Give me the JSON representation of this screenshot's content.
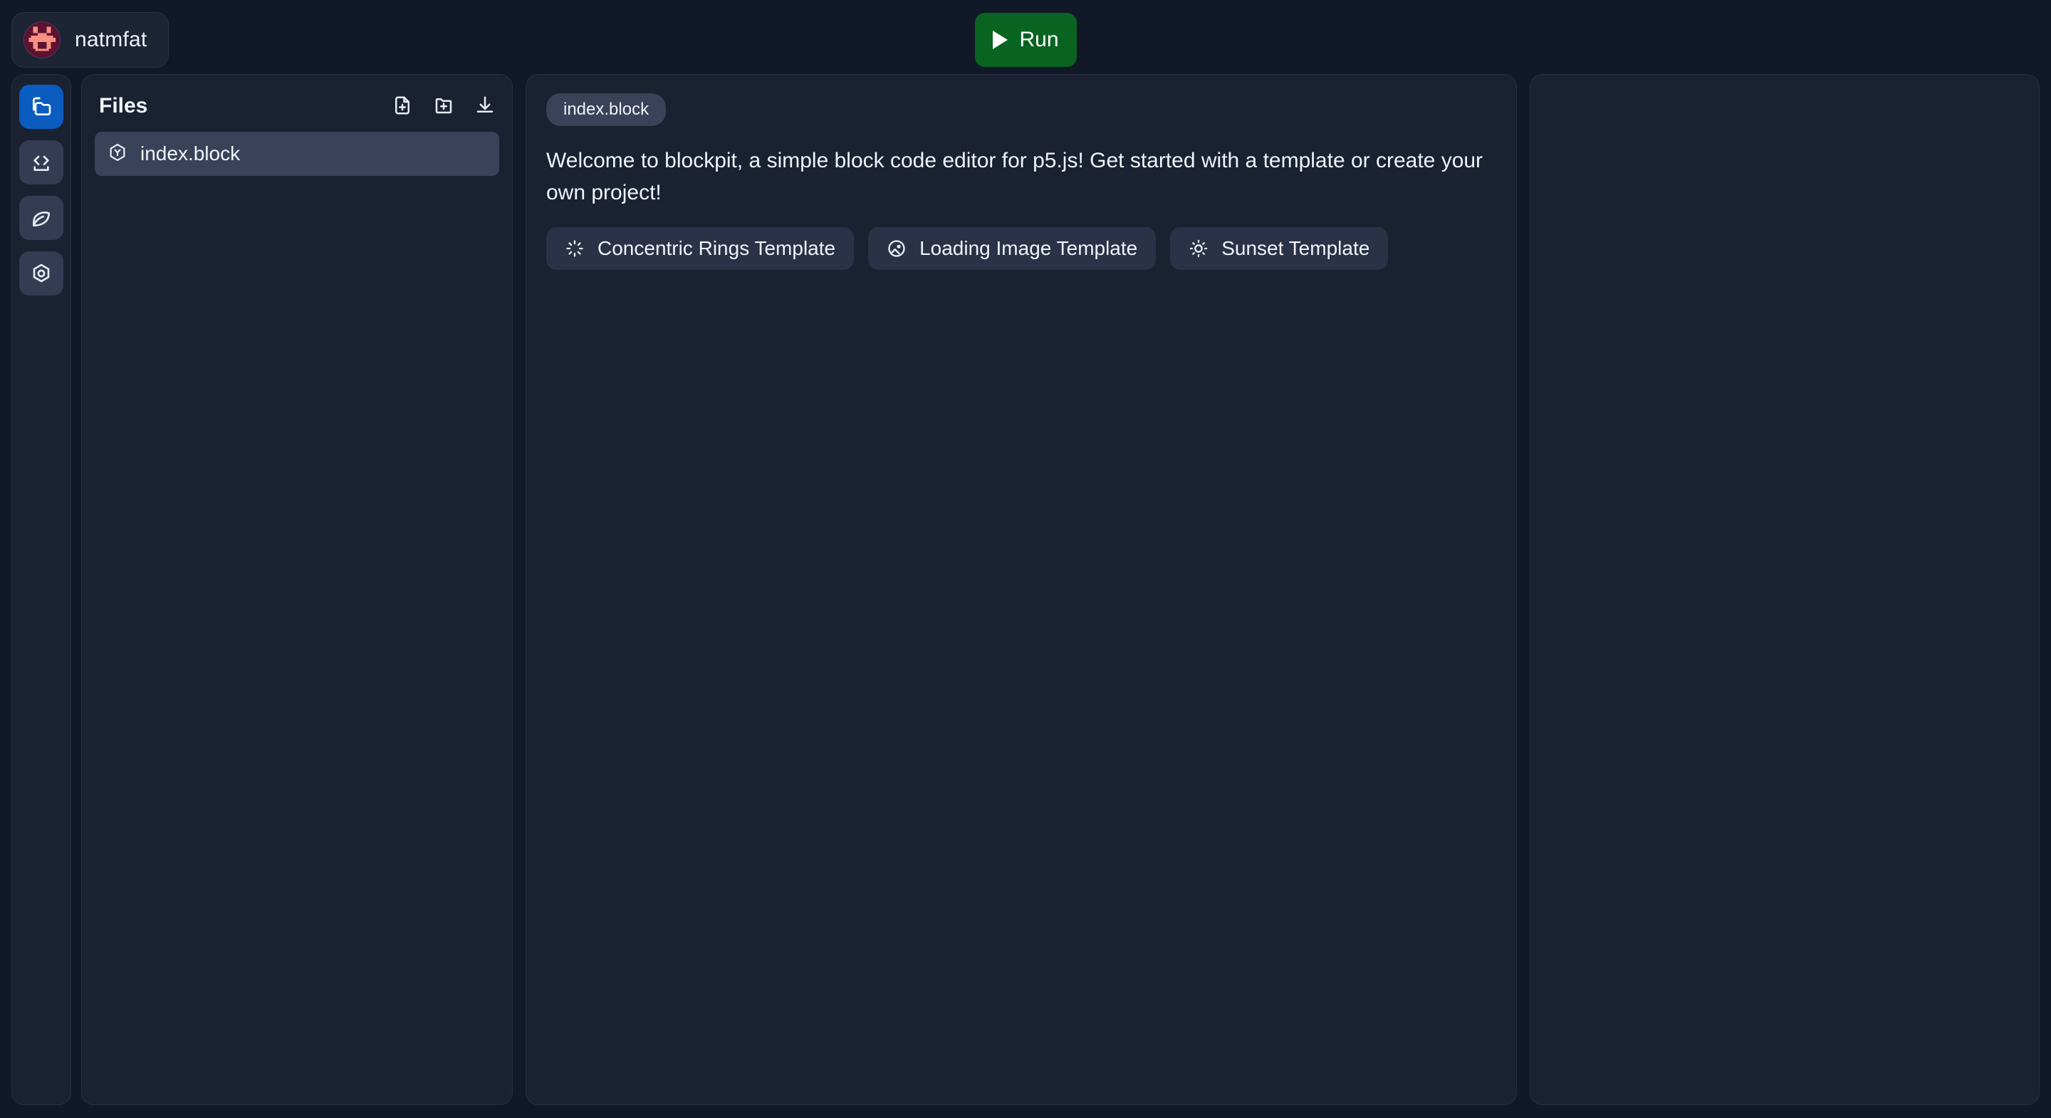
{
  "app": {
    "background": "#111827",
    "panel_bg": "#1a2130",
    "accent": "#0b5cc0",
    "run_green": "#0a6421"
  },
  "topbar": {
    "brand_name": "natmfat",
    "avatar_icon": "pixel-bug-avatar",
    "run_label": "Run",
    "run_icon": "play-icon"
  },
  "rail": {
    "items": [
      {
        "icon": "folder-icon",
        "name": "sidebar-item-files",
        "active": true
      },
      {
        "icon": "code-brackets-icon",
        "name": "sidebar-item-code",
        "active": false
      },
      {
        "icon": "leaf-icon",
        "name": "sidebar-item-p5",
        "active": false
      },
      {
        "icon": "hexagon-icon",
        "name": "sidebar-item-blocks",
        "active": false
      }
    ]
  },
  "files": {
    "title": "Files",
    "actions": [
      {
        "icon": "new-file-icon",
        "name": "new-file-button"
      },
      {
        "icon": "new-folder-icon",
        "name": "new-folder-button"
      },
      {
        "icon": "download-icon",
        "name": "download-button"
      }
    ],
    "items": [
      {
        "icon": "block-hexagon-icon",
        "label": "index.block",
        "selected": true
      }
    ]
  },
  "editor": {
    "tabs": [
      {
        "label": "index.block",
        "active": true
      }
    ],
    "welcome_text": "Welcome to blockpit, a simple block code editor for p5.js! Get started with a template or create your own project!",
    "templates": [
      {
        "label": "Concentric Rings Template",
        "icon": "loader-icon"
      },
      {
        "label": "Loading Image Template",
        "icon": "image-circle-icon"
      },
      {
        "label": "Sunset Template",
        "icon": "sun-icon"
      }
    ]
  },
  "preview": {
    "name": "preview-canvas",
    "content": ""
  }
}
